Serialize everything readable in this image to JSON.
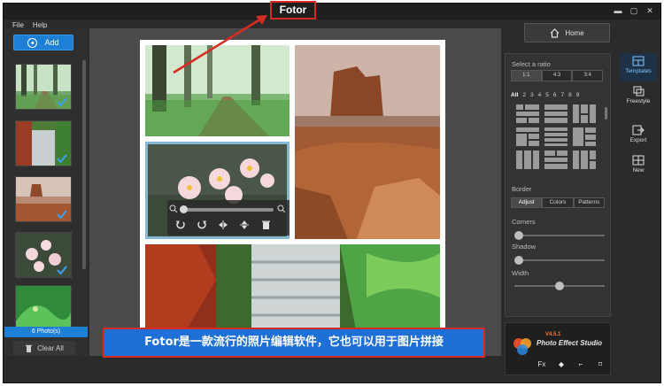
{
  "window": {
    "title": "Fotor"
  },
  "window_controls": [
    "▬",
    "▢",
    "✕"
  ],
  "menu": [
    "File",
    "Help"
  ],
  "sidebar": {
    "add_label": "Add",
    "photo_count": "6 Photo(s)",
    "clear_all_label": "Clear All"
  },
  "home_label": "Home",
  "right_panel": {
    "select_ratio_label": "Select a ratio",
    "ratios": [
      "1:1",
      "4:3",
      "3:4"
    ],
    "selected_ratio": "1:1",
    "template_counts": [
      "All",
      "2",
      "3",
      "4",
      "5",
      "6",
      "7",
      "8",
      "9"
    ],
    "border_label": "Border",
    "border_tabs": [
      "Adjust",
      "Colors",
      "Patterns"
    ],
    "sliders": {
      "corners_label": "Corners",
      "corners_value": 0.05,
      "shadow_label": "Shadow",
      "shadow_value": 0.05,
      "width_label": "Width",
      "width_value": 0.5
    }
  },
  "side_tabs": [
    "Templates",
    "Freestyle",
    "Export",
    "New"
  ],
  "promo": {
    "version": "V4.5.1",
    "name": "Photo Effect Studio",
    "tools": [
      "Fx",
      "◆",
      "⌐",
      "⌑"
    ]
  },
  "caption": "Fotor是一款流行的照片编辑软件，它也可以用于图片拼接",
  "colors": {
    "accent_blue": "#1e7fd6",
    "annotation_red": "#d62a22",
    "panel_bg": "#333333"
  }
}
